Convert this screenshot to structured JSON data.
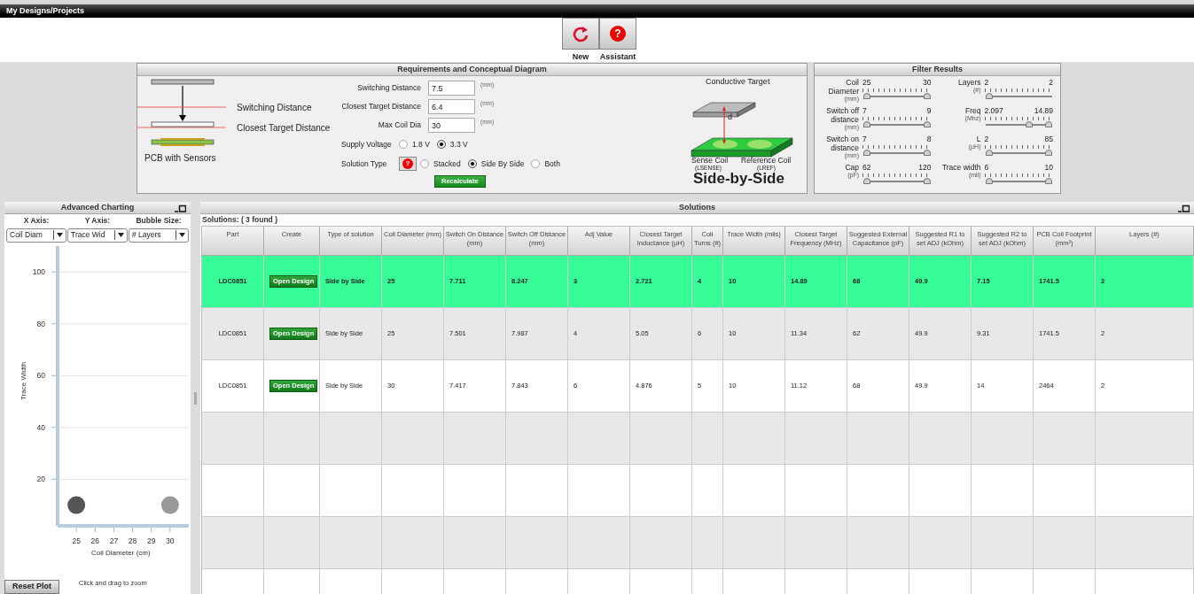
{
  "window": {
    "title": "My Designs/Projects"
  },
  "toolbar": [
    {
      "kind": "new",
      "label": "New"
    },
    {
      "kind": "help",
      "label": "Assistant"
    }
  ],
  "requirements": {
    "title": "Requirements and Conceptual Diagram",
    "diagram_labels": [
      "Switching Distance",
      "Closest Target Distance",
      "PCB with Sensors"
    ],
    "fields": [
      {
        "label": "Switching Distance",
        "value": "7.5",
        "unit": "(mm)"
      },
      {
        "label": "Closest Target Distance",
        "value": "6.4",
        "unit": "(mm)"
      },
      {
        "label": "Max Coil Dia",
        "value": "30",
        "unit": "(mm)"
      }
    ],
    "supply_voltage": {
      "label": "Supply Voltage",
      "options": [
        {
          "label": "1.8 V",
          "selected": false
        },
        {
          "label": "3.3 V",
          "selected": true
        }
      ]
    },
    "solution_type": {
      "label": "Solution Type",
      "help": "?",
      "options": [
        {
          "label": "Stacked",
          "selected": false
        },
        {
          "label": "Side By Side",
          "selected": true
        },
        {
          "label": "Both",
          "selected": false
        }
      ]
    },
    "recalculate": "Recalculate",
    "concept": {
      "target": "Conductive Target",
      "distance": "d",
      "sense_coil": "Sense Coil",
      "sense_sub": "(LSENSE)",
      "reference_coil": "Reference Coil",
      "reference_sub": "(LREF)",
      "caption": "Side-by-Side"
    }
  },
  "filters": {
    "title": "Filter Results",
    "sliders": [
      {
        "label": "Coil Diameter",
        "unit": "(mm)",
        "min": "25",
        "max": "30",
        "thumbs": [
          {
            "level": 0
          },
          {
            "level": 1
          }
        ]
      },
      {
        "label": "Layers",
        "unit": "(#)",
        "min": "2",
        "max": "2",
        "thumbs": [
          {
            "level": 0
          }
        ]
      },
      {
        "label": "Switch off distance",
        "unit": "(mm)",
        "min": "7",
        "max": "9",
        "thumbs": [
          {
            "level": 0
          },
          {
            "level": 1
          }
        ]
      },
      {
        "label": "Freq",
        "unit": "(Mhz)",
        "min": "2.097",
        "max": "14.89",
        "thumbs": [
          {
            "level": 0.68
          },
          {
            "level": 1
          }
        ]
      },
      {
        "label": "Switch on distance",
        "unit": "(mm)",
        "min": "7",
        "max": "8",
        "thumbs": [
          {
            "level": 0
          },
          {
            "level": 1
          }
        ]
      },
      {
        "label": "L",
        "unit": "(µH)",
        "min": "2",
        "max": "85",
        "thumbs": [
          {
            "level": 0
          },
          {
            "level": 1
          }
        ]
      },
      {
        "label": "Cap",
        "unit": "(pF)",
        "min": "62",
        "max": "120",
        "thumbs": [
          {
            "level": 0
          },
          {
            "level": 1
          }
        ]
      },
      {
        "label": "Trace width",
        "unit": "(mil)",
        "min": "6",
        "max": "10",
        "thumbs": [
          {
            "level": 0
          },
          {
            "level": 1
          }
        ]
      }
    ]
  },
  "charting": {
    "title": "Advanced Charting",
    "axes": [
      {
        "label": "X Axis:",
        "value": "Coil Diam"
      },
      {
        "label": "Y Axis:",
        "value": "Trace Wid"
      },
      {
        "label": "Bubble Size:",
        "value": "# Layers"
      }
    ],
    "chart_data": {
      "type": "scatter",
      "xlabel": "Coil Diameter (cm)",
      "ylabel": "Trace Width",
      "x": [
        25,
        30
      ],
      "series": [
        {
          "color": "#555555",
          "values": [
            10,
            null
          ]
        },
        {
          "color": "#999999",
          "values": [
            null,
            10
          ]
        }
      ],
      "grid": true,
      "xlim": [
        24,
        31
      ],
      "ylim": [
        2,
        110
      ],
      "xticks": [
        25,
        26,
        27,
        28,
        29,
        30
      ],
      "yticks": [
        20,
        40,
        60,
        80,
        100
      ]
    },
    "reset": "Reset Plot",
    "hint": "Click and drag to zoom"
  },
  "solutions": {
    "title": "Solutions",
    "summary": "Solutions:  ( 3  found )",
    "columns": [
      "Part",
      "Create",
      "Type of solution",
      "Coil Diameter (mm)",
      "Switch On Distance (mm)",
      "Switch Off Distance (mm)",
      "Adj Value",
      "Closest Target Inductance (µH)",
      "Coil Turns (#)",
      "Trace Width (mils)",
      "Closest Target Frequency (MHz)",
      "Suggested External Capacitance (pF)",
      "Suggested R1 to set ADJ (kOhm)",
      "Suggested R2 to set ADJ (kOhm)",
      "PCB Coil Footprint (mm²)",
      "Layers (#)"
    ],
    "rows": [
      {
        "selected": true,
        "cells": [
          "LDC0851",
          "Open Design",
          "Side by Side",
          "25",
          "7.711",
          "8.247",
          "3",
          "2.721",
          "4",
          "10",
          "14.89",
          "68",
          "49.9",
          "7.15",
          "1741.5",
          "2"
        ]
      },
      {
        "selected": false,
        "cells": [
          "LDC0851",
          "Open Design",
          "Side by Side",
          "25",
          "7.501",
          "7.987",
          "4",
          "5.05",
          "6",
          "10",
          "11.34",
          "62",
          "49.9",
          "9.31",
          "1741.5",
          "2"
        ]
      },
      {
        "selected": false,
        "cells": [
          "LDC0851",
          "Open Design",
          "Side by Side",
          "30",
          "7.417",
          "7.843",
          "6",
          "4.876",
          "5",
          "10",
          "11.12",
          "68",
          "49.9",
          "14",
          "2464",
          "2"
        ]
      }
    ]
  }
}
